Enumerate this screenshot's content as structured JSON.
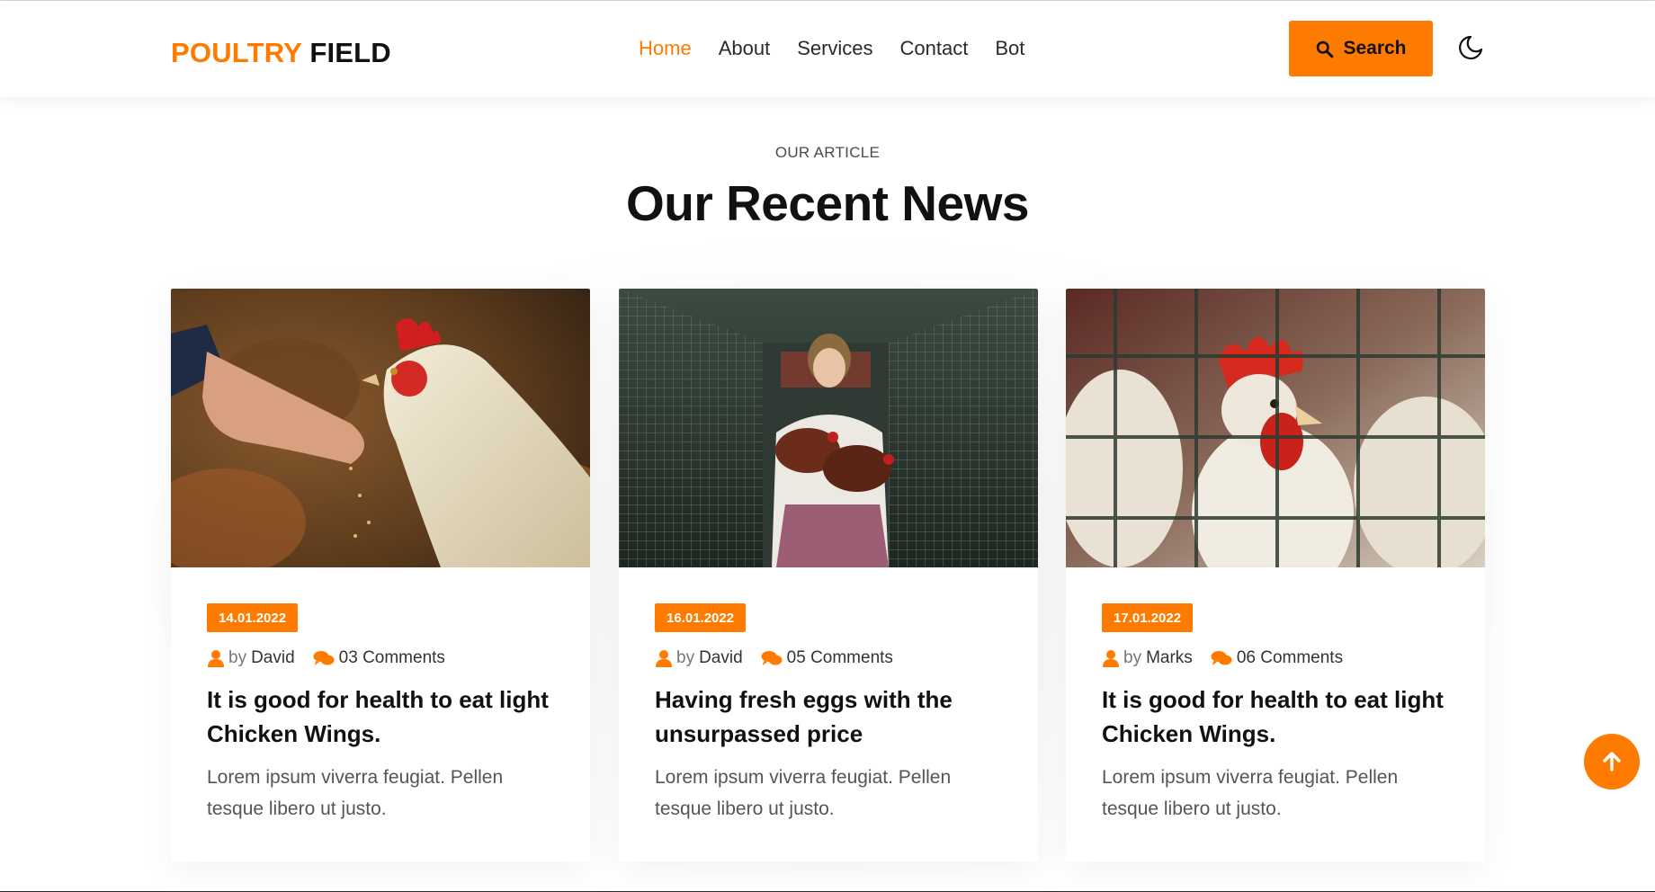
{
  "header": {
    "logo_part1": "POULTRY",
    "logo_part2": "FIELD",
    "nav": [
      {
        "label": "Home"
      },
      {
        "label": "About"
      },
      {
        "label": "Services"
      },
      {
        "label": "Contact"
      },
      {
        "label": "Bot"
      }
    ],
    "active_nav": "Home",
    "search_label": "Search",
    "search_icon": "search-icon",
    "theme_icon": "moon-icon"
  },
  "section": {
    "subtitle": "OUR ARTICLE",
    "title": "Our Recent News"
  },
  "cards": [
    {
      "date": "14.01.2022",
      "by": "by",
      "author": "David",
      "comments": "03 Comments",
      "title": "It is good for health to eat light Chicken Wings.",
      "text": "Lorem ipsum viverra feugiat. Pellen tesque libero ut justo.",
      "image": "hand-feeding-rooster-photo"
    },
    {
      "date": "16.01.2022",
      "by": "by",
      "author": "David",
      "comments": "05 Comments",
      "title": "Having fresh eggs with the unsurpassed price",
      "text": "Lorem ipsum viverra feugiat. Pellen tesque libero ut justo.",
      "image": "woman-holding-hens-photo"
    },
    {
      "date": "17.01.2022",
      "by": "by",
      "author": "Marks",
      "comments": "06 Comments",
      "title": "It is good for health to eat light Chicken Wings.",
      "text": "Lorem ipsum viverra feugiat. Pellen tesque libero ut justo.",
      "image": "caged-hen-photo"
    }
  ],
  "colors": {
    "accent": "#ff7b00",
    "text_dark": "#111111",
    "text_muted": "#555555"
  },
  "back_to_top_icon": "arrow-up-icon"
}
